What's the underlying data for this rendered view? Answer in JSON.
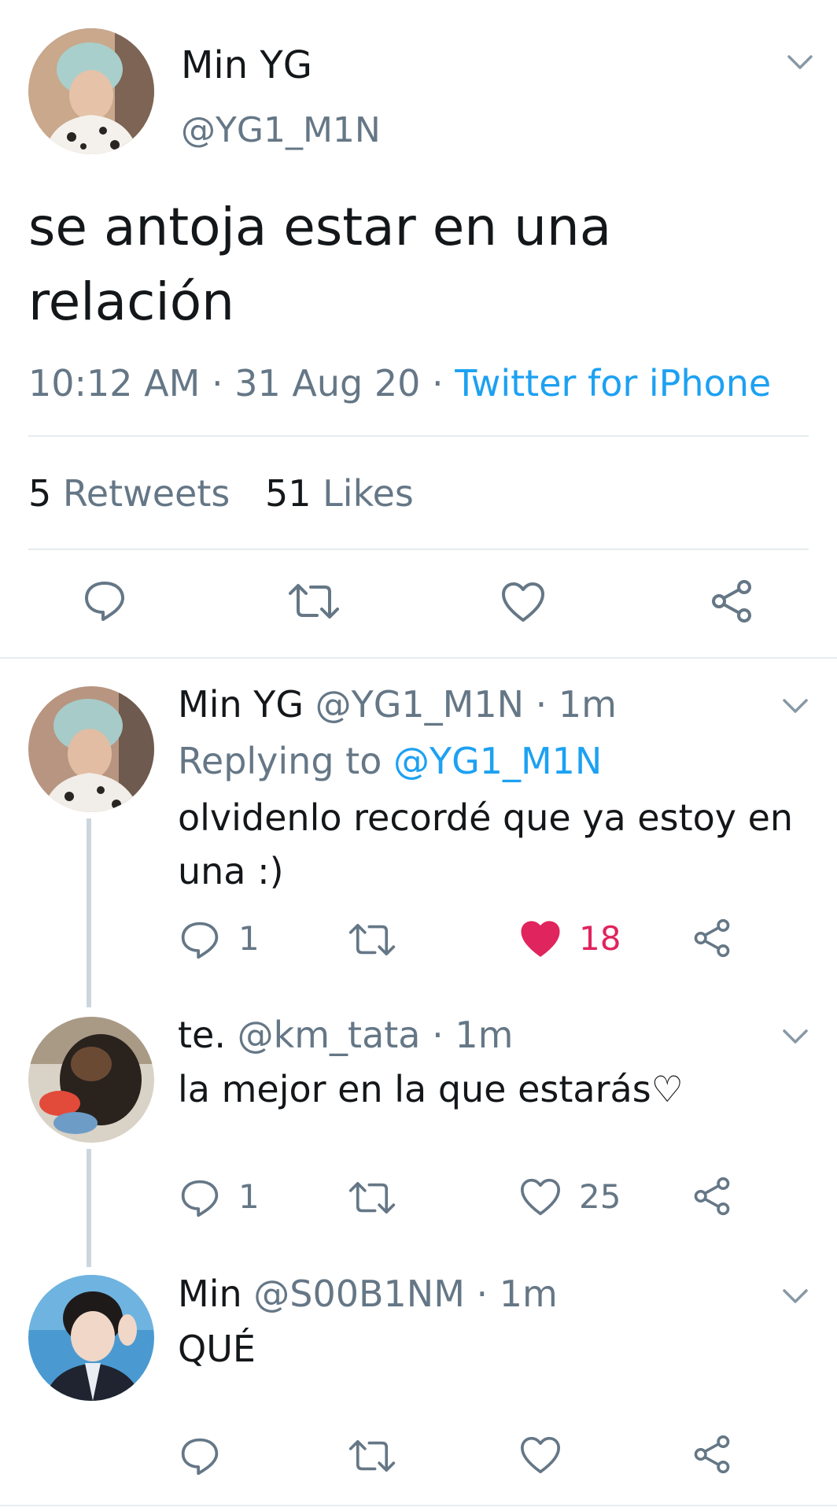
{
  "main_tweet": {
    "display_name": "Min YG",
    "handle": "@YG1_M1N",
    "text_line1": "se antoja estar en una",
    "text_line2": "relación",
    "time": "10:12 AM",
    "date": "31 Aug 20",
    "source": "Twitter for iPhone",
    "sep": "·",
    "retweets_count": "5",
    "retweets_label": "Retweets",
    "likes_count": "51",
    "likes_label": "Likes"
  },
  "replies": [
    {
      "display_name": "Min YG",
      "handle": "@YG1_M1N",
      "time": "· 1m",
      "replying_prefix": "Replying to",
      "replying_handle": "@YG1_M1N",
      "text_line1": "olvidenlo recordé que ya estoy en",
      "text_line2": "una :)",
      "reply_count": "1",
      "like_count": "18",
      "liked": true
    },
    {
      "display_name": "te.",
      "handle": "@km_tata",
      "time": "· 1m",
      "text_line1": "la mejor en la que estarás♡",
      "reply_count": "1",
      "like_count": "25",
      "liked": false
    },
    {
      "display_name": "Min",
      "handle": "@S00B1NM",
      "time": "· 1m",
      "text_line1": "QUÉ",
      "liked": false
    }
  ],
  "colors": {
    "like_active": "#e0245e",
    "link": "#1da1f2",
    "secondary_text": "#657786"
  },
  "icons": [
    "chevron-down-icon",
    "reply-icon",
    "retweet-icon",
    "heart-icon",
    "share-icon"
  ]
}
